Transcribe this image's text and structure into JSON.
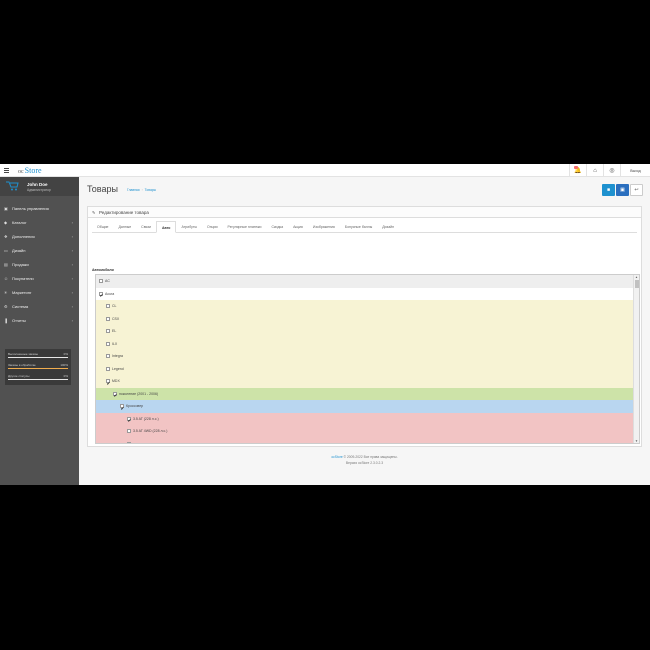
{
  "header": {
    "logo_prefix": "oc",
    "logo_main": "Store",
    "logout_label": "Выход"
  },
  "sidebar": {
    "user_name": "John Doe",
    "user_role": "Администратор",
    "items": [
      {
        "label": "Панель управления",
        "icon": "dashboard-icon",
        "has_children": false
      },
      {
        "label": "Каталог",
        "icon": "tag-icon",
        "has_children": true
      },
      {
        "label": "Дополнения",
        "icon": "puzzle-icon",
        "has_children": true
      },
      {
        "label": "Дизайн",
        "icon": "monitor-icon",
        "has_children": true
      },
      {
        "label": "Продажи",
        "icon": "cart-icon",
        "has_children": true
      },
      {
        "label": "Покупатели",
        "icon": "user-icon",
        "has_children": true
      },
      {
        "label": "Маркетинг",
        "icon": "share-icon",
        "has_children": true
      },
      {
        "label": "Система",
        "icon": "gear-icon",
        "has_children": true
      },
      {
        "label": "Отчеты",
        "icon": "bar-chart-icon",
        "has_children": true
      }
    ],
    "stats": [
      {
        "label": "Выполненные заказы",
        "percent": "0%",
        "value": 0.0,
        "color": "#e8e8e8"
      },
      {
        "label": "Заказы в обработке",
        "percent": "100%",
        "value": 1.0,
        "color": "#f0ad4e"
      },
      {
        "label": "Другие статусы",
        "percent": "0%",
        "value": 0.0,
        "color": "#e8e8e8"
      }
    ]
  },
  "page": {
    "title": "Товары",
    "breadcrumb_home": "Главная",
    "breadcrumb_current": "Товары",
    "panel_title": "Редактирование товара",
    "tabs": [
      {
        "label": "Общие",
        "active": false
      },
      {
        "label": "Данные",
        "active": false
      },
      {
        "label": "Связи",
        "active": false
      },
      {
        "label": "Авто",
        "active": true
      },
      {
        "label": "Атрибуты",
        "active": false
      },
      {
        "label": "Опции",
        "active": false
      },
      {
        "label": "Регулярные платежи",
        "active": false
      },
      {
        "label": "Скидка",
        "active": false
      },
      {
        "label": "Акция",
        "active": false
      },
      {
        "label": "Изображения",
        "active": false
      },
      {
        "label": "Бонусные баллы",
        "active": false
      },
      {
        "label": "Дизайн",
        "active": false
      }
    ],
    "field_label": "Автомобили",
    "tree": [
      {
        "label": "AC",
        "level": 0,
        "checked": false,
        "bg": "#eeeeee"
      },
      {
        "label": "Acura",
        "level": 0,
        "checked": true,
        "bg": "#ffffff"
      },
      {
        "label": "CL",
        "level": 1,
        "checked": false,
        "bg": "#f7f3d4"
      },
      {
        "label": "CSX",
        "level": 1,
        "checked": false,
        "bg": "#f7f3d4"
      },
      {
        "label": "EL",
        "level": 1,
        "checked": false,
        "bg": "#f7f3d4"
      },
      {
        "label": "ILX",
        "level": 1,
        "checked": false,
        "bg": "#f7f3d4"
      },
      {
        "label": "Integra",
        "level": 1,
        "checked": false,
        "bg": "#f7f3d4"
      },
      {
        "label": "Legend",
        "level": 1,
        "checked": false,
        "bg": "#f7f3d4"
      },
      {
        "label": "MDX",
        "level": 1,
        "checked": true,
        "bg": "#f7f3d4"
      },
      {
        "label": "поколение (2001 - 2006)",
        "level": 2,
        "checked": true,
        "bg": "#cde3a8"
      },
      {
        "label": "Кроссовер",
        "level": 3,
        "checked": true,
        "bg": "#b9d6f0"
      },
      {
        "label": "3.5 AT (228 л.с.)",
        "level": 4,
        "checked": true,
        "bg": "#f2c4c4"
      },
      {
        "label": "3.5 AT 4WD (228 л.с.)",
        "level": 4,
        "checked": false,
        "bg": "#f2c4c4"
      },
      {
        "label": "",
        "level": 4,
        "checked": false,
        "bg": "#f2c4c4"
      }
    ]
  },
  "footer": {
    "brand": "ocStore",
    "copyright": " © 2009-2022 Все права защищены.",
    "version": "Версия ocStore 2.3.0.2.3"
  }
}
